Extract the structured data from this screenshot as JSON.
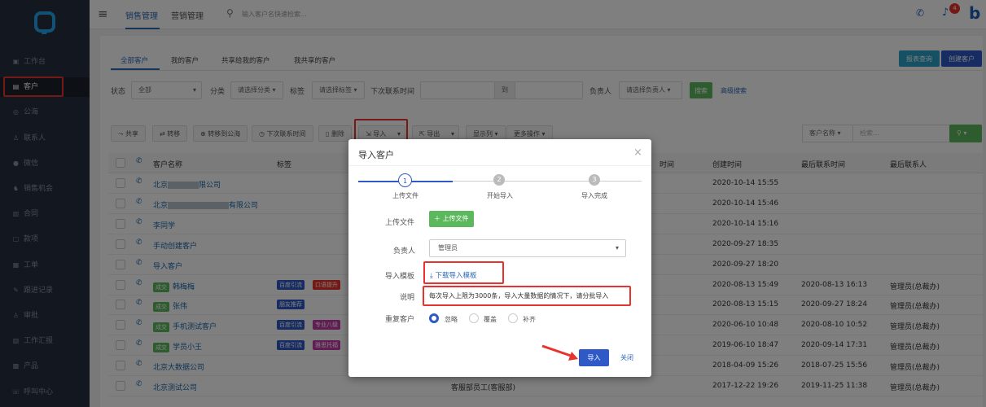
{
  "sidebar": {
    "items": [
      {
        "label": "工作台",
        "icon": "dashboard-icon",
        "glyph": "▣"
      },
      {
        "label": "客户",
        "icon": "document-icon",
        "glyph": "▤"
      },
      {
        "label": "公海",
        "icon": "sea-icon",
        "glyph": "◎"
      },
      {
        "label": "联系人",
        "icon": "contact-icon",
        "glyph": "♙"
      },
      {
        "label": "微信",
        "icon": "wechat-icon",
        "glyph": "●"
      },
      {
        "label": "销售机会",
        "icon": "opportunity-icon",
        "glyph": "♞"
      },
      {
        "label": "合同",
        "icon": "contract-icon",
        "glyph": "▥"
      },
      {
        "label": "款项",
        "icon": "payment-icon",
        "glyph": "▢"
      },
      {
        "label": "工单",
        "icon": "ticket-icon",
        "glyph": "▦"
      },
      {
        "label": "跟进记录",
        "icon": "followup-icon",
        "glyph": "✎"
      },
      {
        "label": "审批",
        "icon": "approval-icon",
        "glyph": "♙"
      },
      {
        "label": "工作汇报",
        "icon": "report-icon",
        "glyph": "▧"
      },
      {
        "label": "产品",
        "icon": "product-icon",
        "glyph": "▩"
      },
      {
        "label": "呼叫中心",
        "icon": "call-center-icon",
        "glyph": "☏"
      }
    ]
  },
  "top": {
    "menu_icon": "≡",
    "tab1": "销售管理",
    "tab2": "营销管理",
    "search_placeholder": "输入客户名快速检索...",
    "notif_count": "4",
    "logo_letter": "b"
  },
  "sub_tabs": [
    "全部客户",
    "我的客户",
    "共享给我的客户",
    "我共享的客户"
  ],
  "buttons": {
    "report_query": "报表查询",
    "create_customer": "创建客户",
    "search": "搜索",
    "advanced_search": "高级搜索"
  },
  "filters": {
    "status_label": "状态",
    "status_value": "全部",
    "category_label": "分类",
    "category_value": "请选择分类",
    "tag_label": "标签",
    "tag_value": "请选择标签",
    "next_contact_label": "下次联系时间",
    "to": "到",
    "owner_label": "负责人",
    "owner_value": "请选择负责人"
  },
  "toolbar": {
    "share": "共享",
    "transfer": "转移",
    "to_sea": "转移到公海",
    "next_contact": "下次联系时间",
    "delete": "删除",
    "import": "导入",
    "export": "导出",
    "columns": "显示列",
    "more": "更多操作",
    "customer_name": "客户名称",
    "search_placeholder": "检索..."
  },
  "table": {
    "headers": {
      "name": "客户名称",
      "tags": "标签",
      "last_time_partial": "时间",
      "created": "创建时间",
      "last_contact": "最后联系时间",
      "last_contact_person": "最后联系人"
    },
    "rows": [
      {
        "name": "北京",
        "name_suffix": "限公司",
        "created": "2020-10-14 15:55",
        "last_contact": "",
        "person": "",
        "badge": "",
        "tags": []
      },
      {
        "name": "北京",
        "name_suffix": "有限公司",
        "created": "2020-10-14 15:46",
        "last_contact": "",
        "person": "",
        "badge": "",
        "tags": []
      },
      {
        "name": "李同学",
        "name_suffix": "",
        "created": "2020-10-14 15:16",
        "last_contact": "",
        "person": "",
        "badge": "",
        "tags": []
      },
      {
        "name": "手动创建客户",
        "name_suffix": "",
        "created": "2020-09-27 18:35",
        "last_contact": "",
        "person": "",
        "badge": "",
        "tags": []
      },
      {
        "name": "导入客户",
        "name_suffix": "",
        "created": "2020-09-27 18:20",
        "last_contact": "",
        "person": "",
        "badge": "",
        "tags": []
      },
      {
        "name": "韩梅梅",
        "name_suffix": "",
        "created": "2020-08-13 15:49",
        "last_contact": "2020-08-13 16:13",
        "person": "管理员(总裁办)",
        "badge": "成交",
        "tags": [
          {
            "t": "百度引流",
            "c": "#2e59c6"
          },
          {
            "t": "口语提升",
            "c": "#e8322b"
          }
        ]
      },
      {
        "name": "张伟",
        "name_suffix": "",
        "created": "2020-08-13 15:15",
        "last_contact": "2020-09-27 18:24",
        "person": "管理员(总裁办)",
        "badge": "成交",
        "tags": [
          {
            "t": "朋友推荐",
            "c": "#2e59c6"
          }
        ]
      },
      {
        "name": "手机测试客户",
        "name_suffix": "",
        "created": "2020-06-10 10:48",
        "last_contact": "2020-08-10 10:52",
        "person": "管理员(总裁办)",
        "badge": "成交",
        "tags": [
          {
            "t": "百度引流",
            "c": "#2e59c6"
          },
          {
            "t": "专业八级",
            "c": "#c23aa8"
          }
        ]
      },
      {
        "name": "学员小王",
        "name_suffix": "",
        "created": "2019-06-10 18:47",
        "last_contact": "2020-09-14 17:31",
        "person": "管理员(总裁办)",
        "badge": "成交",
        "tags": [
          {
            "t": "百度引流",
            "c": "#2e59c6"
          },
          {
            "t": "雅思托福",
            "c": "#c23aa8"
          }
        ]
      },
      {
        "name": "北京大数据公司",
        "name_suffix": "",
        "created": "2018-04-09 15:26",
        "last_contact": "2018-07-25 15:56",
        "person": "管理员(总裁办)",
        "badge": "",
        "tags": []
      },
      {
        "name": "北京测试公司",
        "name_suffix": "",
        "created": "2017-12-22 19:26",
        "last_contact": "2019-11-25 11:38",
        "person": "管理员(总裁办)",
        "badge": "",
        "tags": [],
        "owner": "客服部员工(客服部)"
      }
    ]
  },
  "modal": {
    "title": "导入客户",
    "close": "×",
    "steps": [
      {
        "n": "1",
        "label": "上传文件"
      },
      {
        "n": "2",
        "label": "开始导入"
      },
      {
        "n": "3",
        "label": "导入完成"
      }
    ],
    "upload_label": "上传文件",
    "upload_button": "上传文件",
    "owner_label": "负责人",
    "owner_value": "管理员",
    "template_label": "导入模板",
    "template_link": "下载导入模板",
    "desc_label": "说明",
    "desc_text": "每次导入上限为3000条，导入大量数据的情况下，请分批导入",
    "dup_label": "重复客户",
    "dup_options": [
      "忽略",
      "覆盖",
      "补齐"
    ],
    "import_button": "导入",
    "close_button": "关闭"
  }
}
